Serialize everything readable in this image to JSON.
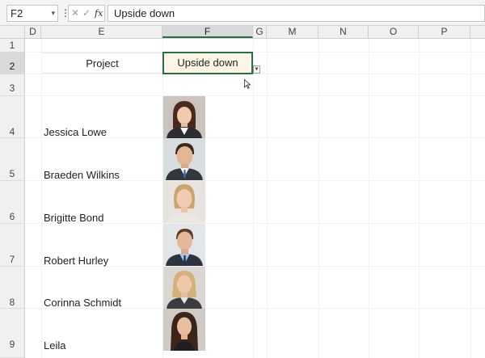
{
  "formula_bar": {
    "name_box": "F2",
    "name_box_chevron": "chevron-down-icon",
    "more_icon": "more-vertical-icon",
    "cancel_icon": "close-icon",
    "enter_icon": "check-icon",
    "fx_label": "fx",
    "value": "Upside down"
  },
  "columns": [
    "D",
    "E",
    "F",
    "G",
    "M",
    "N",
    "O",
    "P"
  ],
  "selected_column": "F",
  "rows": [
    "1",
    "2",
    "3",
    "4",
    "5",
    "6",
    "7",
    "8",
    "9"
  ],
  "selected_row": "2",
  "sheet": {
    "project_label": "Project",
    "active_cell_value": "Upside down",
    "dropdown_icon": "dropdown-arrow-icon",
    "people": [
      {
        "name": "Jessica Lowe",
        "photo": "female-portrait-dark-hair"
      },
      {
        "name": "Braeden Wilkins",
        "photo": "male-portrait-suit"
      },
      {
        "name": "Brigitte Bond",
        "photo": "female-portrait-blonde"
      },
      {
        "name": "Robert Hurley",
        "photo": "male-portrait-blue-shirt"
      },
      {
        "name": "Corinna Schmidt",
        "photo": "female-portrait-blonde-older"
      },
      {
        "name": "Leila",
        "photo": "female-portrait-long-hair"
      }
    ]
  },
  "colors": {
    "accent": "#217346",
    "active_cell_fill": "#fff5e6"
  }
}
